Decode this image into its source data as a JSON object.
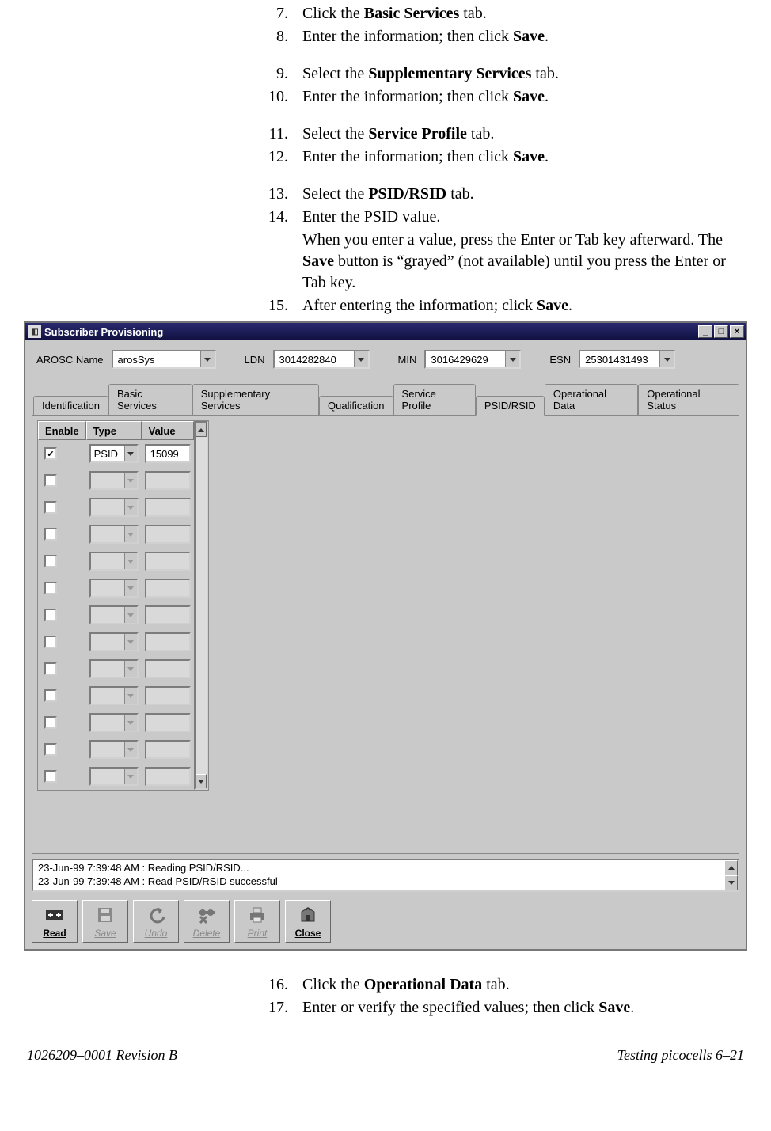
{
  "steps_top": [
    {
      "num": "7.",
      "parts": [
        "Click the ",
        {
          "b": "Basic Services"
        },
        " tab."
      ]
    },
    {
      "num": "8.",
      "parts": [
        "Enter the information; then click ",
        {
          "b": "Save"
        },
        "."
      ]
    },
    {
      "gap": true
    },
    {
      "num": "9.",
      "parts": [
        "Select the ",
        {
          "b": "Supplementary Services"
        },
        " tab."
      ]
    },
    {
      "num": "10.",
      "parts": [
        "Enter the information; then click ",
        {
          "b": "Save"
        },
        "."
      ]
    },
    {
      "gap": true
    },
    {
      "num": "11.",
      "parts": [
        "Select the ",
        {
          "b": "Service Profile"
        },
        " tab."
      ]
    },
    {
      "num": "12.",
      "parts": [
        "Enter the information; then click ",
        {
          "b": "Save"
        },
        "."
      ]
    },
    {
      "gap": true
    },
    {
      "num": "13.",
      "parts": [
        "Select the ",
        {
          "b": "PSID/RSID"
        },
        " tab."
      ]
    },
    {
      "num": "14.",
      "parts": [
        "Enter the PSID value."
      ],
      "sub": [
        "When you enter a value, press the Enter or Tab key afterward. The ",
        {
          "b": "Save"
        },
        " button is “grayed” (not available) until you press the Enter or Tab key."
      ]
    },
    {
      "num": "15.",
      "parts": [
        "After entering the information; click ",
        {
          "b": "Save"
        },
        "."
      ]
    }
  ],
  "steps_bottom": [
    {
      "num": "16.",
      "parts": [
        "Click the ",
        {
          "b": "Operational Data"
        },
        " tab."
      ]
    },
    {
      "num": "17.",
      "parts": [
        "Enter or verify the specified values; then click ",
        {
          "b": "Save"
        },
        "."
      ]
    }
  ],
  "window": {
    "title": "Subscriber Provisioning",
    "header": {
      "arosc_label": "AROSC Name",
      "arosc_value": "arosSys",
      "ldn_label": "LDN",
      "ldn_value": "3014282840",
      "min_label": "MIN",
      "min_value": "3016429629",
      "esn_label": "ESN",
      "esn_value": "25301431493"
    },
    "tabs": [
      "Identification",
      "Basic Services",
      "Supplementary Services",
      "Qualification",
      "Service Profile",
      "PSID/RSID",
      "Operational Data",
      "Operational Status"
    ],
    "active_tab_index": 5,
    "grid": {
      "headers": [
        "Enable",
        "Type",
        "Value"
      ],
      "rows": [
        {
          "enabled": true,
          "type": "PSID",
          "value": "15099"
        },
        {
          "enabled": false,
          "type": "",
          "value": ""
        },
        {
          "enabled": false,
          "type": "",
          "value": ""
        },
        {
          "enabled": false,
          "type": "",
          "value": ""
        },
        {
          "enabled": false,
          "type": "",
          "value": ""
        },
        {
          "enabled": false,
          "type": "",
          "value": ""
        },
        {
          "enabled": false,
          "type": "",
          "value": ""
        },
        {
          "enabled": false,
          "type": "",
          "value": ""
        },
        {
          "enabled": false,
          "type": "",
          "value": ""
        },
        {
          "enabled": false,
          "type": "",
          "value": ""
        },
        {
          "enabled": false,
          "type": "",
          "value": ""
        },
        {
          "enabled": false,
          "type": "",
          "value": ""
        },
        {
          "enabled": false,
          "type": "",
          "value": ""
        }
      ]
    },
    "status_lines": [
      "23-Jun-99 7:39:48 AM : Reading PSID/RSID...",
      "23-Jun-99 7:39:48 AM : Read PSID/RSID successful"
    ],
    "toolbar": [
      {
        "id": "read",
        "label": "Read",
        "disabled": false
      },
      {
        "id": "save",
        "label": "Save",
        "disabled": true
      },
      {
        "id": "undo",
        "label": "Undo",
        "disabled": true
      },
      {
        "id": "delete",
        "label": "Delete",
        "disabled": true
      },
      {
        "id": "print",
        "label": "Print",
        "disabled": true
      },
      {
        "id": "close",
        "label": "Close",
        "disabled": false
      }
    ]
  },
  "footer": {
    "left": "1026209–0001  Revision B",
    "right": "Testing picocells   6–21"
  }
}
